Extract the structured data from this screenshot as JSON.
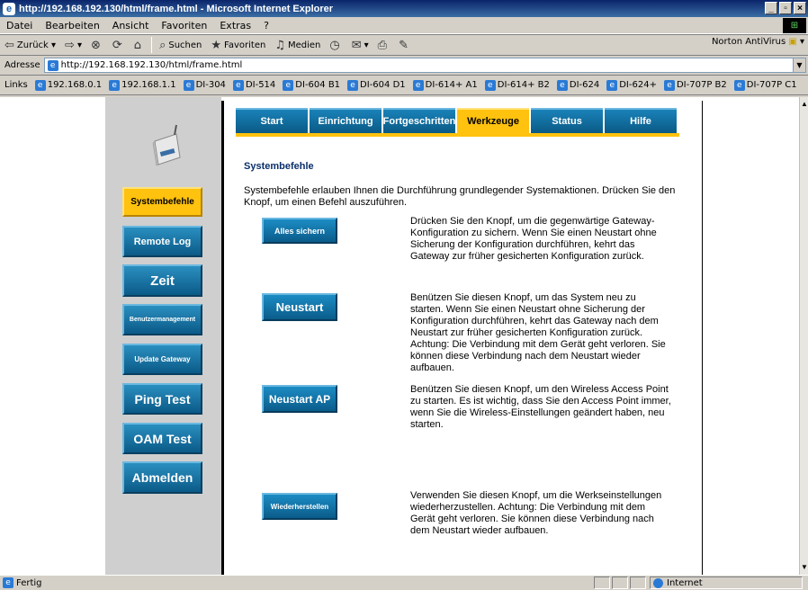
{
  "window": {
    "title": "http://192.168.192.130/html/frame.html - Microsoft Internet Explorer"
  },
  "menu": [
    "Datei",
    "Bearbeiten",
    "Ansicht",
    "Favoriten",
    "Extras",
    "?"
  ],
  "toolbar": {
    "back": "Zurück",
    "search": "Suchen",
    "favorites": "Favoriten",
    "media": "Medien",
    "norton": "Norton AntiVirus"
  },
  "address": {
    "label": "Adresse",
    "url": "http://192.168.192.130/html/frame.html"
  },
  "links": {
    "label": "Links",
    "items": [
      "192.168.0.1",
      "192.168.1.1",
      "DI-304",
      "DI-514",
      "DI-604 B1",
      "DI-604 D1",
      "DI-614+ A1",
      "DI-614+ B2",
      "DI-624",
      "DI-624+",
      "DI-707P B2",
      "DI-707P C1"
    ]
  },
  "tabs": [
    "Start",
    "Einrichtung",
    "Fortgeschritten",
    "Werkzeuge",
    "Status",
    "Hilfe"
  ],
  "active_tab": "Werkzeuge",
  "sidebar": [
    {
      "label": "Systembefehle",
      "active": true
    },
    {
      "label": "Remote Log"
    },
    {
      "label": "Zeit"
    },
    {
      "label": "Benutzermanagement"
    },
    {
      "label": "Update Gateway"
    },
    {
      "label": "Ping Test"
    },
    {
      "label": "OAM Test"
    },
    {
      "label": "Abmelden"
    }
  ],
  "main": {
    "title": "Systembefehle",
    "intro": "Systembefehle erlauben Ihnen die Durchführung grundlegender Systemaktionen. Drücken Sie den Knopf, um einen Befehl auszuführen.",
    "actions": [
      {
        "button": "Alles sichern",
        "description": "Drücken Sie den Knopf, um die gegenwärtige Gateway-Konfiguration zu sichern. Wenn Sie einen Neustart ohne Sicherung der Konfiguration durchführen, kehrt das Gateway zur früher gesicherten Konfiguration zurück."
      },
      {
        "button": "Neustart",
        "description": "Benützen Sie diesen Knopf, um das System neu zu starten. Wenn Sie einen Neustart ohne Sicherung der Konfiguration durchführen, kehrt das Gateway nach dem Neustart zur früher gesicherten Konfiguration zurück. Achtung: Die Verbindung mit dem Gerät geht verloren. Sie können diese Verbindung nach dem Neustart wieder aufbauen."
      },
      {
        "button": "Neustart AP",
        "description": "Benützen Sie diesen Knopf, um den Wireless Access Point zu starten. Es ist wichtig, dass Sie den Access Point immer, wenn Sie die Wireless-Einstellungen geändert haben, neu starten."
      },
      {
        "button": "Wiederherstellen",
        "description": "Verwenden Sie diesen Knopf, um die Werkseinstellungen wiederherzustellen. Achtung: Die Verbindung mit dem Gerät geht verloren. Sie können diese Verbindung nach dem Neustart wieder aufbauen."
      }
    ]
  },
  "status": {
    "text": "Fertig",
    "zone": "Internet"
  },
  "colors": {
    "accent": "#ffc20e",
    "button": "#0b6fa4",
    "title": "#0a2f6b"
  }
}
